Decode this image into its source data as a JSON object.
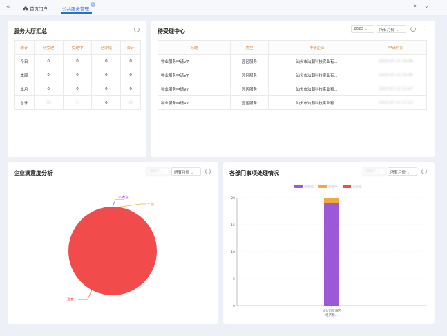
{
  "tabs": {
    "home_label": "首页门户",
    "active_label": "公共服务管理",
    "close_glyph": "×",
    "left_arrow": "«",
    "right_arrow": "»",
    "right_chevron": "⌄"
  },
  "hall_summary": {
    "title": "服务大厅汇总",
    "headers": [
      "统计",
      "待受理",
      "受理中",
      "已办结",
      "合计"
    ],
    "rows": [
      [
        "今日",
        "0",
        "0",
        "0",
        "0"
      ],
      [
        "本周",
        "0",
        "0",
        "0",
        "0"
      ],
      [
        "本月",
        "0",
        "0",
        "0",
        "0"
      ],
      [
        "总计",
        "19",
        "1",
        "0",
        "20"
      ]
    ]
  },
  "pending_center": {
    "title": "待受理中心",
    "year_select": "2023",
    "month_select": "所有月份",
    "more_glyph": "⋮",
    "headers": [
      "标题",
      "类型",
      "申请企业",
      "申请时间"
    ],
    "rows": [
      [
        "物业服务申请V7",
        "园区服务",
        "汕头市汕潮科技实业有...",
        "2023-07-11 14:08"
      ],
      [
        "物业服务申请V7",
        "园区服务",
        "汕头市汕潮科技实业有...",
        "2023-07-11 14:08"
      ],
      [
        "物业服务申请V7",
        "园区服务",
        "汕头市汕潮科技实业有...",
        "2023-07-11 13:47"
      ],
      [
        "物业服务申请V7",
        "园区服务",
        "汕头市汕潮科技实业有...",
        "2023-07-11 17:22"
      ]
    ]
  },
  "satisfaction": {
    "title": "企业满意度分析",
    "year_select": "2023",
    "month_select": "所有月份"
  },
  "department": {
    "title": "各部门事项处理情况",
    "year_select": "2023",
    "month_select": "所有月份"
  },
  "chart_data": [
    {
      "type": "pie",
      "labels": [
        "不满意",
        "一般",
        "满意"
      ],
      "values": [
        0,
        0,
        20
      ],
      "colors": [
        "#9b59d9",
        "#f5a83a",
        "#f24b4b"
      ]
    },
    {
      "type": "bar",
      "stacked": true,
      "categories": [
        "汕头市澄海区经济和..."
      ],
      "series": [
        {
          "name": "待受理",
          "values": [
            19
          ],
          "color": "#9b59d9"
        },
        {
          "name": "受理中",
          "values": [
            1
          ],
          "color": "#f5a83a"
        },
        {
          "name": "已办结",
          "values": [
            0
          ],
          "color": "#f24b4b"
        }
      ],
      "ylim": [
        0,
        20
      ],
      "yticks": [
        0,
        5,
        10,
        15,
        20
      ],
      "legend_position": "top"
    }
  ]
}
